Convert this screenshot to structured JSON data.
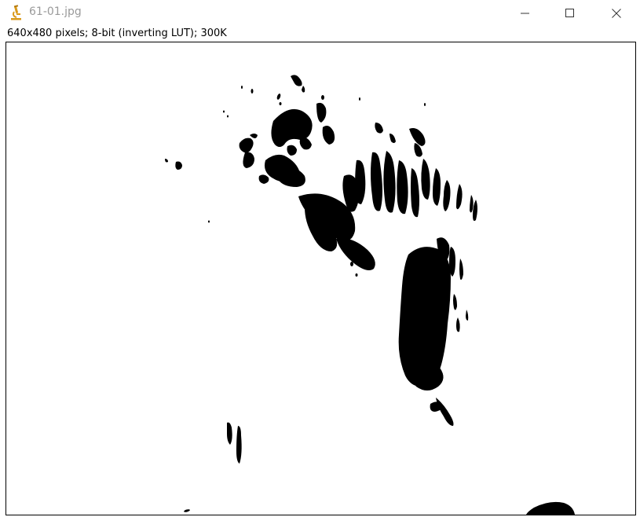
{
  "window": {
    "title": "61-01.jpg",
    "app_icon": "imagej-microscope-icon",
    "controls": {
      "minimize_icon": "minimize-icon",
      "maximize_icon": "maximize-icon",
      "close_icon": "close-icon"
    }
  },
  "image_info": {
    "text": "640x480 pixels; 8-bit (inverting LUT); 300K"
  },
  "image": {
    "description_icon": "binary-thresholded-image",
    "foreground_color": "#000000",
    "background_color": "#ffffff"
  }
}
